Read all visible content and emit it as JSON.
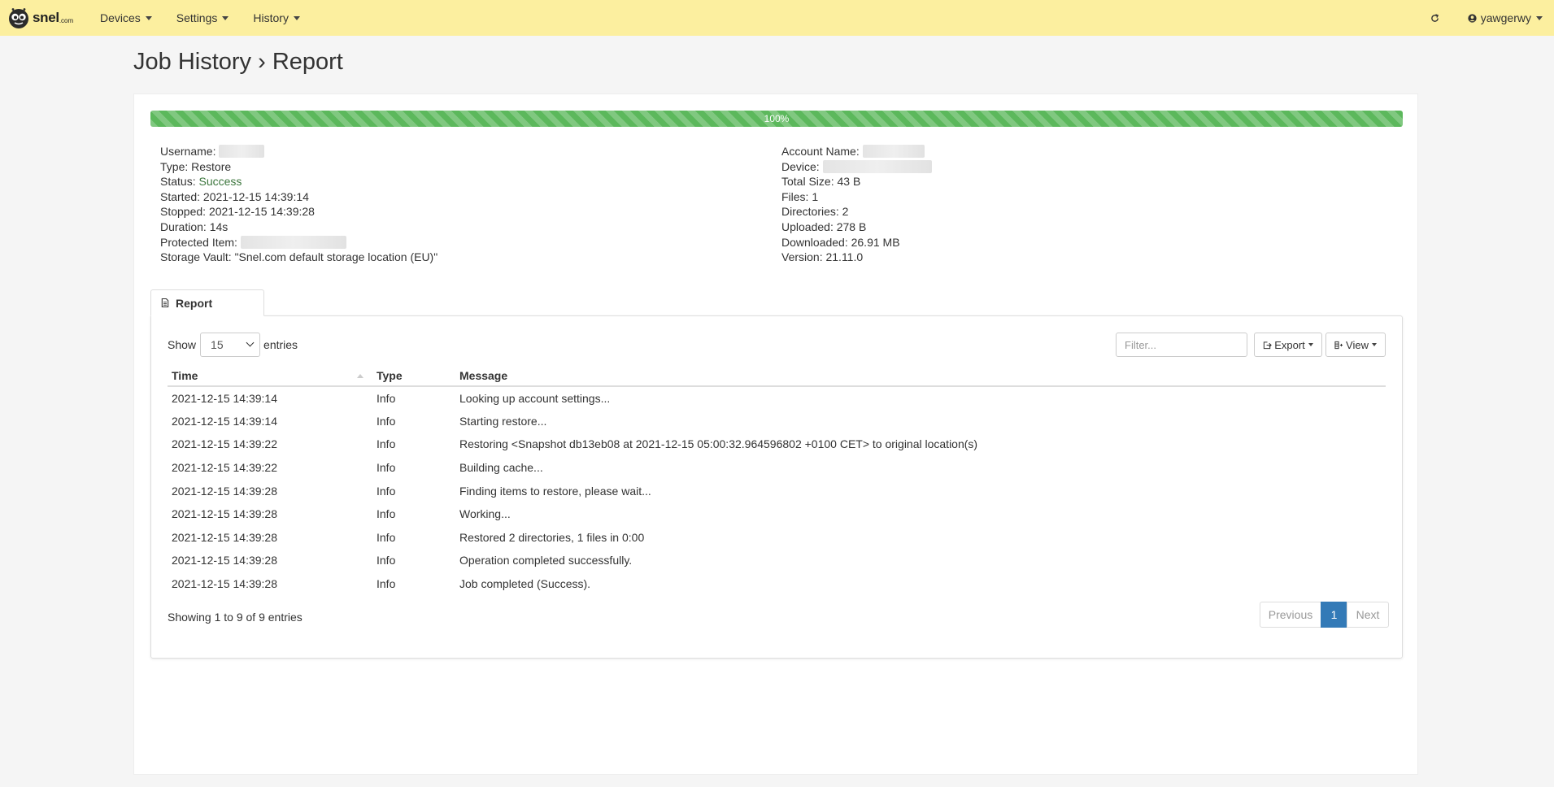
{
  "nav": {
    "brand": "snel",
    "brand_suffix": ".com",
    "menus": [
      {
        "label": "Devices"
      },
      {
        "label": "Settings"
      },
      {
        "label": "History"
      }
    ],
    "user": "yawgerwy"
  },
  "page": {
    "title": "Job History › Report"
  },
  "job": {
    "progress_label": "100%",
    "progress_value": 100,
    "progress_color": "#5cb85c",
    "left": {
      "username_label": "Username:",
      "type": "Type: Restore",
      "status_label": "Status:",
      "status_value": "Success",
      "started": "Started: 2021-12-15 14:39:14",
      "stopped": "Stopped: 2021-12-15 14:39:28",
      "duration": "Duration: 14s",
      "protected_label": "Protected Item:",
      "storage_vault": "Storage Vault: \"Snel.com default storage location (EU)\""
    },
    "right": {
      "account_label": "Account Name:",
      "device_label": "Device:",
      "total_size": "Total Size: 43 B",
      "files": "Files: 1",
      "directories": "Directories: 2",
      "uploaded": "Uploaded: 278 B",
      "downloaded": "Downloaded: 26.91 MB",
      "version": "Version: 21.11.0"
    }
  },
  "report": {
    "tab_label": "Report",
    "show_label": "Show",
    "page_size": "15",
    "entries_label": "entries",
    "filter_placeholder": "Filter...",
    "export_label": "Export",
    "view_label": "View",
    "columns": [
      "Time",
      "Type",
      "Message"
    ],
    "rows": [
      [
        "2021-12-15 14:39:14",
        "Info",
        "Looking up account settings..."
      ],
      [
        "2021-12-15 14:39:14",
        "Info",
        "Starting restore..."
      ],
      [
        "2021-12-15 14:39:22",
        "Info",
        "Restoring <Snapshot db13eb08 at 2021-12-15 05:00:32.964596802 +0100 CET> to original location(s)"
      ],
      [
        "2021-12-15 14:39:22",
        "Info",
        "Building cache..."
      ],
      [
        "2021-12-15 14:39:28",
        "Info",
        "Finding items to restore, please wait..."
      ],
      [
        "2021-12-15 14:39:28",
        "Info",
        "Working..."
      ],
      [
        "2021-12-15 14:39:28",
        "Info",
        "Restored 2 directories, 1 files in 0:00"
      ],
      [
        "2021-12-15 14:39:28",
        "Info",
        "Operation completed successfully."
      ],
      [
        "2021-12-15 14:39:28",
        "Info",
        "Job completed (Success)."
      ]
    ],
    "info": "Showing 1 to 9 of 9 entries",
    "pagination": {
      "previous": "Previous",
      "current": "1",
      "next": "Next"
    }
  }
}
